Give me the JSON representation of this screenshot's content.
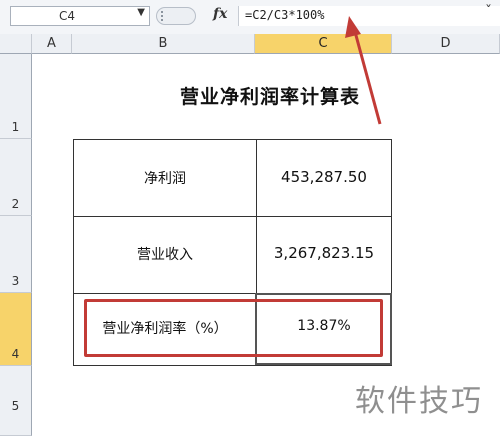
{
  "formula_bar": {
    "name_box": "C4",
    "fx_label": "fx",
    "formula": "=C2/C3*100%"
  },
  "columns": [
    "A",
    "B",
    "C",
    "D"
  ],
  "rows": [
    "1",
    "2",
    "3",
    "4",
    "5"
  ],
  "selected": {
    "column": "C",
    "row": "4"
  },
  "sheet": {
    "title": "营业净利润率计算表",
    "table": [
      {
        "label": "净利润",
        "value": "453,287.50"
      },
      {
        "label": "营业收入",
        "value": "3,267,823.15"
      },
      {
        "label": "营业净利润率（%）",
        "value": "13.87%"
      }
    ]
  },
  "watermark": "软件技巧",
  "colors": {
    "highlight_box": "#c23b36",
    "arrow": "#c23b36",
    "selected_header": "#f7d36a"
  }
}
